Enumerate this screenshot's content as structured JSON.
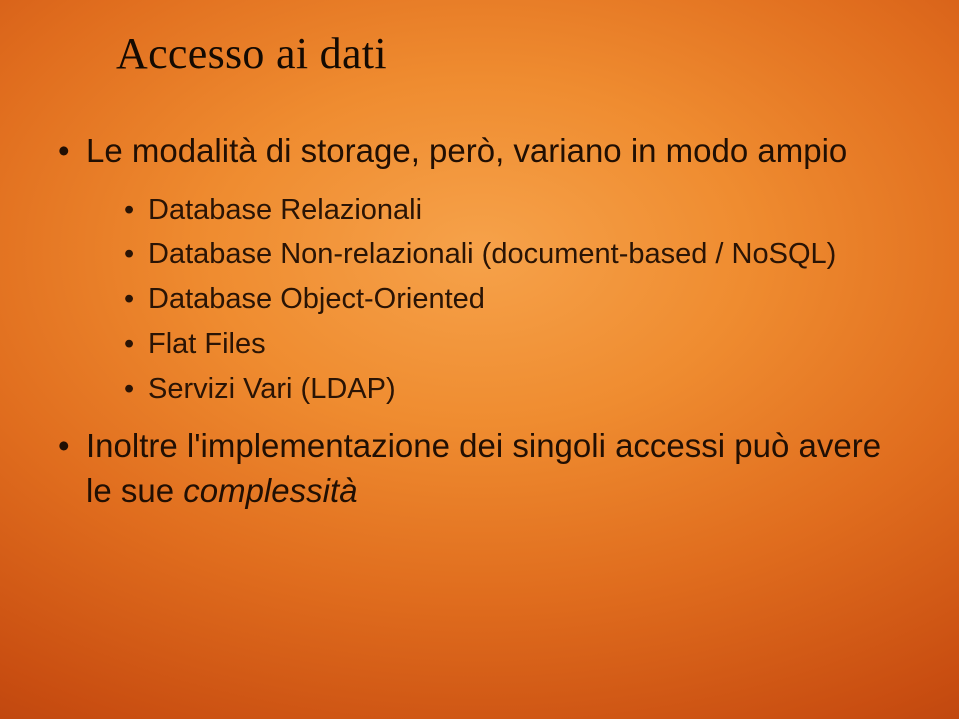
{
  "title": "Accesso ai dati",
  "bullets": {
    "b1": "Le modalità di storage, però, variano in modo ampio",
    "sub": {
      "s1": "Database Relazionali",
      "s2": "Database Non-relazionali (document-based / NoSQL)",
      "s3": "Database Object-Oriented",
      "s4": "Flat Files",
      "s5": "Servizi Vari (LDAP)"
    },
    "b2_pre": "Inoltre l'implementazione dei singoli accessi può avere le sue ",
    "b2_em": "complessità"
  }
}
